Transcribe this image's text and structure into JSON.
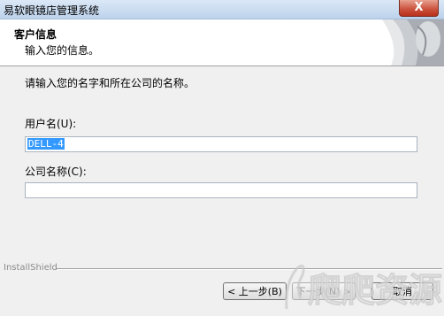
{
  "window": {
    "title": "易软眼镜店管理系统",
    "close_label": "X"
  },
  "header": {
    "title": "客户信息",
    "subtitle": "输入您的信息。"
  },
  "content": {
    "instruction": "请输入您的名字和所在公司的名称。",
    "username_label": "用户名(U):",
    "username_value": "DELL-4",
    "company_label": "公司名称(C):",
    "company_value": ""
  },
  "footer": {
    "brand": "InstallShield",
    "back_label": "< 上一步(B)",
    "next_label": "下一步(N) >",
    "cancel_label": "取消",
    "watermark_text": "爬爬资源"
  }
}
